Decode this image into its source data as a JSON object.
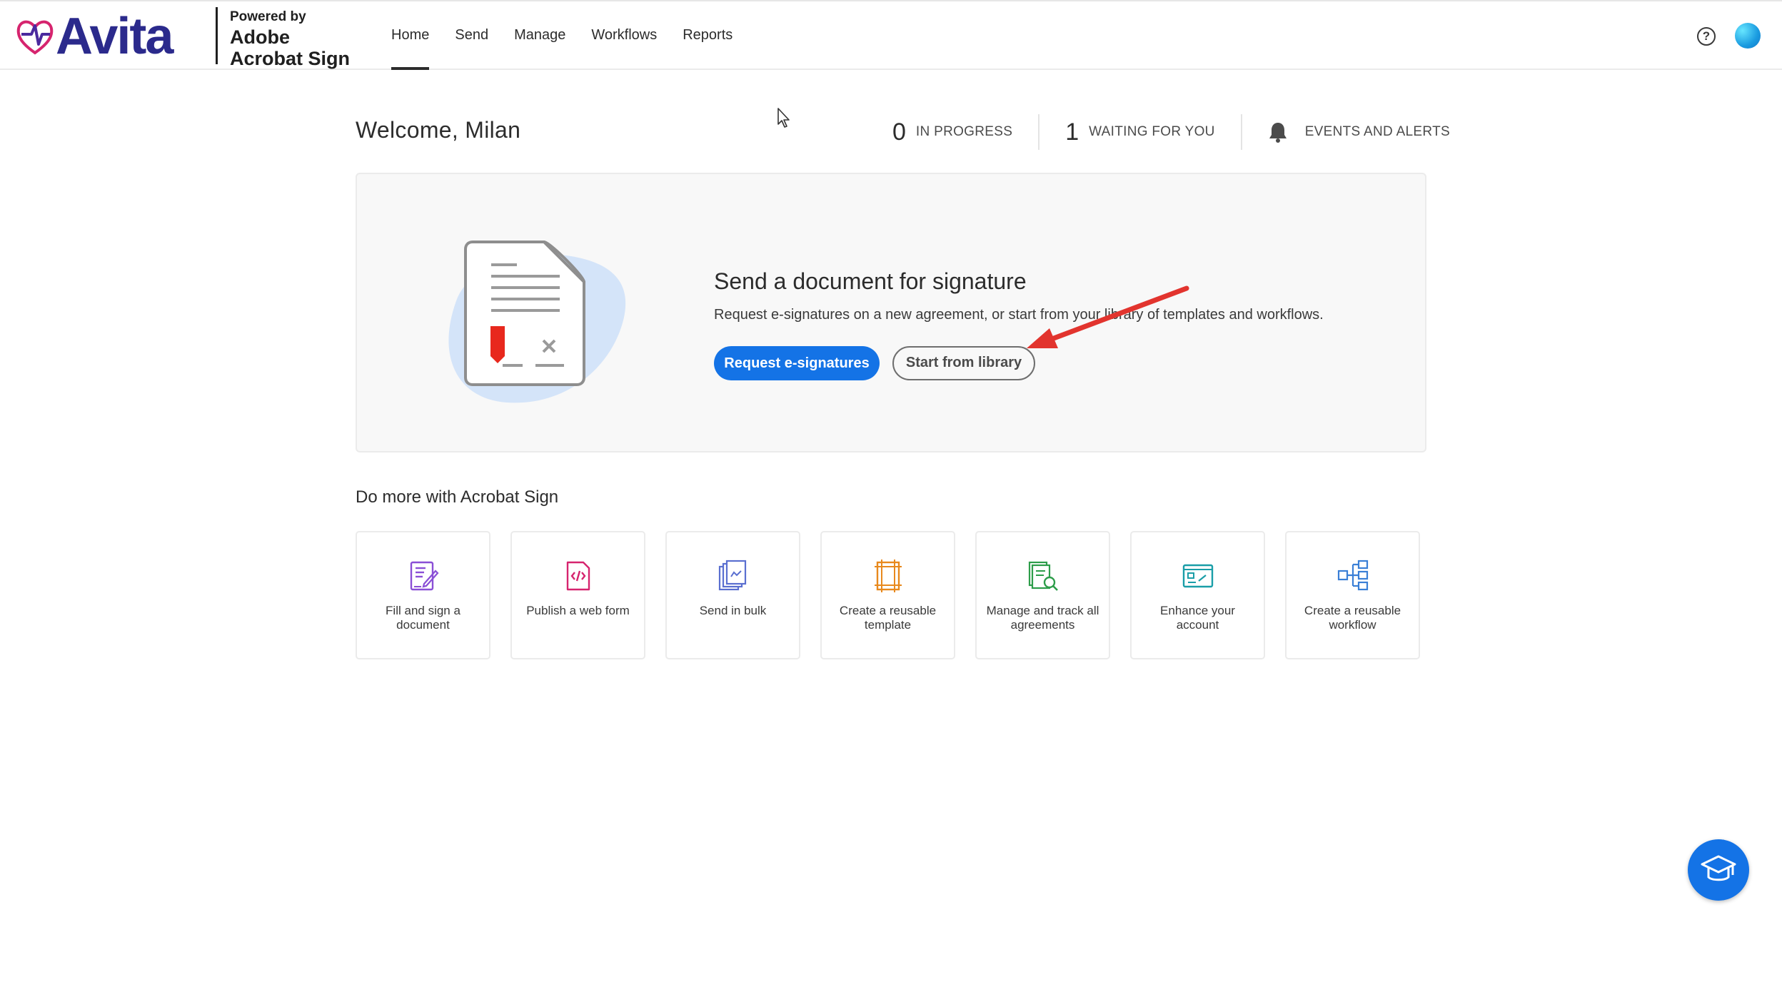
{
  "header": {
    "logo_text": "Avita",
    "powered_line1": "Powered by",
    "powered_line2": "Adobe",
    "powered_line3": "Acrobat Sign",
    "nav": [
      {
        "label": "Home",
        "active": true
      },
      {
        "label": "Send",
        "active": false
      },
      {
        "label": "Manage",
        "active": false
      },
      {
        "label": "Workflows",
        "active": false
      },
      {
        "label": "Reports",
        "active": false
      }
    ],
    "help_icon": "?"
  },
  "welcome": {
    "text": "Welcome, Milan"
  },
  "stats": {
    "in_progress_count": "0",
    "in_progress_label": "IN PROGRESS",
    "waiting_count": "1",
    "waiting_label": "WAITING FOR YOU",
    "events_label": "EVENTS AND ALERTS"
  },
  "send_card": {
    "title": "Send a document for signature",
    "description": "Request e-signatures on a new agreement, or start from your library of templates and workflows.",
    "primary_button": "Request e-signatures",
    "secondary_button": "Start from library"
  },
  "do_more": {
    "title": "Do more with Acrobat Sign",
    "tiles": [
      {
        "line1": "Fill and sign a",
        "line2": "document",
        "icon": "fill-sign-icon"
      },
      {
        "line1": "Publish a web form",
        "line2": "",
        "icon": "web-form-icon"
      },
      {
        "line1": "Send in bulk",
        "line2": "",
        "icon": "send-bulk-icon"
      },
      {
        "line1": "Create a reusable",
        "line2": "template",
        "icon": "template-icon"
      },
      {
        "line1": "Manage and track all",
        "line2": "agreements",
        "icon": "manage-track-icon"
      },
      {
        "line1": "Enhance your",
        "line2": "account",
        "icon": "enhance-account-icon"
      },
      {
        "line1": "Create a reusable",
        "line2": "workflow",
        "icon": "workflow-icon"
      }
    ]
  },
  "colors": {
    "brand_blue": "#1473e6",
    "logo_navy": "#2b2a8c",
    "annotation_red": "#e2342e"
  }
}
